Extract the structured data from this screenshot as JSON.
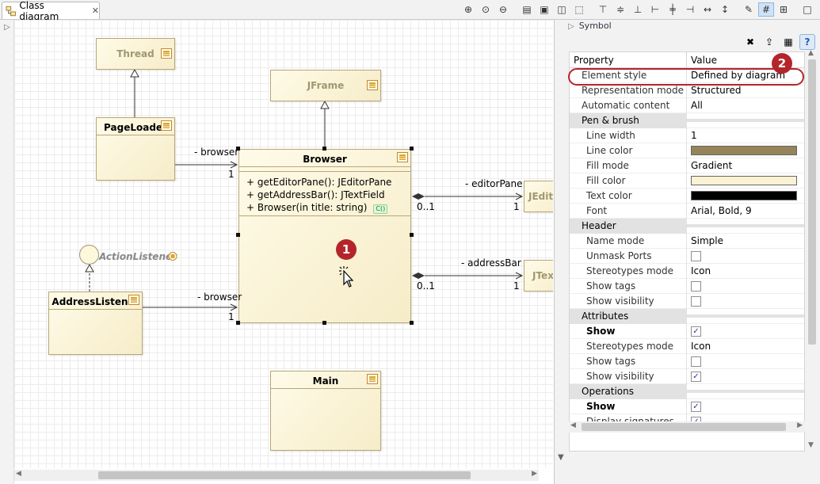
{
  "tab": {
    "title": "Class diagram",
    "close": "✕"
  },
  "toolbar": [
    "zoom-in-icon",
    "zoom-reset-icon",
    "zoom-out-icon",
    "sep",
    "print-icon",
    "save-icon",
    "export-image-icon",
    "select-rect-icon",
    "sep",
    "align-top-icon",
    "align-middle-icon",
    "align-bottom-icon",
    "align-left-icon",
    "align-center-icon",
    "align-right-icon",
    "same-width-icon",
    "same-height-icon",
    "sep",
    "format-brush-icon",
    "grid-icon",
    "snap-icon",
    "sep",
    "expand-icon"
  ],
  "diagram": {
    "classes": {
      "thread": "Thread",
      "jframe": "JFrame",
      "pageloader": "PageLoader",
      "browser": "Browser",
      "jeditor": "JEdito",
      "jtext": "JTex",
      "addresslistener": "AddressListener",
      "main": "Main"
    },
    "browser_ops": [
      "+ getEditorPane(): JEditorPane",
      "+ getAddressBar(): JTextField",
      "+ Browser(in title: string)"
    ],
    "ctor_badge": "C()",
    "interface": "ActionListener",
    "labels": {
      "browser1": "- browser",
      "browser2": "- browser",
      "editorPane": "- editorPane",
      "addressBar": "- addressBar",
      "one_a": "1",
      "one_b": "1",
      "one_c": "1",
      "one_d": "1",
      "zero1_a": "0..1",
      "zero1_b": "0..1"
    },
    "callout1": "1"
  },
  "panel": {
    "title": "Symbol",
    "tools": [
      "delete-style-icon",
      "move-up-icon",
      "style-icon",
      "help-icon"
    ],
    "help": "?",
    "header": {
      "property": "Property",
      "value": "Value"
    },
    "callout2": "2",
    "rows": [
      {
        "name": "Element style",
        "value": "Defined by diagram",
        "kind": "lvl1"
      },
      {
        "name": "Representation mode",
        "value": "Structured",
        "kind": "lvl1"
      },
      {
        "name": "Automatic content",
        "value": "All",
        "kind": "lvl1"
      },
      {
        "name": "Pen & brush",
        "value": "",
        "kind": "cat"
      },
      {
        "name": "Line width",
        "value": "1",
        "kind": "sub"
      },
      {
        "name": "Line color",
        "color": "#95845a",
        "kind": "sub"
      },
      {
        "name": "Fill mode",
        "value": "Gradient",
        "kind": "sub"
      },
      {
        "name": "Fill color",
        "color": "#fbf1d3",
        "kind": "sub"
      },
      {
        "name": "Text color",
        "color": "#000000",
        "kind": "sub"
      },
      {
        "name": "Font",
        "value": "Arial, Bold, 9",
        "kind": "sub"
      },
      {
        "name": "Header",
        "value": "",
        "kind": "cat"
      },
      {
        "name": "Name mode",
        "value": "Simple",
        "kind": "sub"
      },
      {
        "name": "Unmask Ports",
        "check": false,
        "kind": "sub"
      },
      {
        "name": "Stereotypes mode",
        "value": "Icon",
        "kind": "sub"
      },
      {
        "name": "Show tags",
        "check": false,
        "kind": "sub"
      },
      {
        "name": "Show visibility",
        "check": false,
        "kind": "sub"
      },
      {
        "name": "Attributes",
        "value": "",
        "kind": "cat"
      },
      {
        "name": "Show",
        "check": true,
        "kind": "sub",
        "bold": true
      },
      {
        "name": "Stereotypes mode",
        "value": "Icon",
        "kind": "sub"
      },
      {
        "name": "Show tags",
        "check": false,
        "kind": "sub"
      },
      {
        "name": "Show visibility",
        "check": true,
        "kind": "sub"
      },
      {
        "name": "Operations",
        "value": "",
        "kind": "cat"
      },
      {
        "name": "Show",
        "check": true,
        "kind": "sub",
        "bold": true
      },
      {
        "name": "Display signatures",
        "check": true,
        "kind": "sub"
      }
    ]
  },
  "colors": {
    "accent_red": "#b4252b",
    "class_border": "#b7a77a"
  }
}
